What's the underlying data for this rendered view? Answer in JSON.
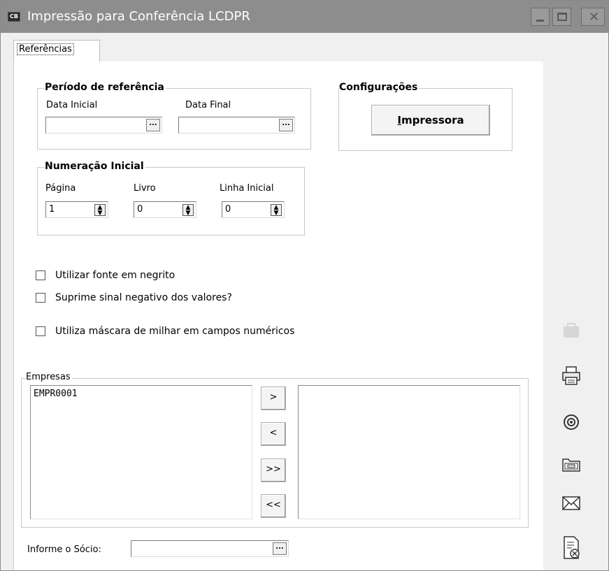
{
  "window": {
    "app_icon_text": "CB",
    "title": "Impressão para Conferência LCDPR"
  },
  "tabs": [
    {
      "label": "Referências"
    }
  ],
  "periodo": {
    "title": "Período de referência",
    "data_inicial_label": "Data Inicial",
    "data_inicial_value": "",
    "data_final_label": "Data Final",
    "data_final_value": "",
    "ellipsis": "..."
  },
  "configuracoes": {
    "title": "Configurações",
    "impressora_label_first": "I",
    "impressora_label_rest": "mpressora"
  },
  "numeracao": {
    "title": "Numeração Inicial",
    "pagina_label": "Página",
    "pagina_value": "1",
    "livro_label": "Livro",
    "livro_value": "0",
    "linha_label": "Linha Inicial",
    "linha_value": "0"
  },
  "options": [
    {
      "label": "Utilizar fonte em negrito",
      "checked": false
    },
    {
      "label": "Suprime sinal negativo dos valores?",
      "checked": false
    },
    {
      "label": "Utiliza máscara de milhar em campos numéricos",
      "checked": false
    }
  ],
  "empresas": {
    "title": "Empresas",
    "available": [
      "EMPR0001"
    ],
    "selected": [],
    "btn_add": ">",
    "btn_remove": "<",
    "btn_add_all": ">>",
    "btn_remove_all": "<<"
  },
  "socio": {
    "label": "Informe o Sócio:",
    "value": "",
    "ellipsis": "..."
  },
  "toolbar_icons": [
    "briefcase-icon",
    "printer-icon",
    "preview-eye-icon",
    "folder-icon",
    "email-icon",
    "cancel-document-icon"
  ]
}
